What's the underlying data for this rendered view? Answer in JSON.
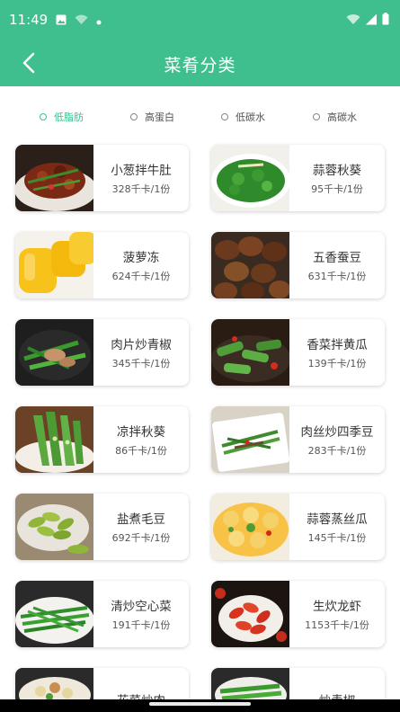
{
  "status_bar": {
    "time": "11:49",
    "left_icons": [
      "image-icon",
      "wifi-off-icon",
      "notification-dot-icon"
    ],
    "right_icons": [
      "wifi-icon",
      "signal-icon",
      "battery-icon"
    ]
  },
  "app_bar": {
    "title": "菜肴分类",
    "back_icon": "chevron-left-icon"
  },
  "colors": {
    "primary": "#3fbf8e"
  },
  "filters": [
    {
      "label": "低脂肪",
      "selected": true
    },
    {
      "label": "高蛋白",
      "selected": false
    },
    {
      "label": "低碳水",
      "selected": false
    },
    {
      "label": "高碳水",
      "selected": false
    }
  ],
  "dishes": [
    {
      "name": "小葱拌牛肚",
      "calories": "328千卡/1份"
    },
    {
      "name": "蒜蓉秋葵",
      "calories": "95千卡/1份"
    },
    {
      "name": "菠萝冻",
      "calories": "624千卡/1份"
    },
    {
      "name": "五香蚕豆",
      "calories": "631千卡/1份"
    },
    {
      "name": "肉片炒青椒",
      "calories": "345千卡/1份"
    },
    {
      "name": "香菜拌黄瓜",
      "calories": "139千卡/1份"
    },
    {
      "name": "凉拌秋葵",
      "calories": "86千卡/1份"
    },
    {
      "name": "肉丝炒四季豆",
      "calories": "283千卡/1份"
    },
    {
      "name": "盐煮毛豆",
      "calories": "692千卡/1份"
    },
    {
      "name": "蒜蓉蒸丝瓜",
      "calories": "145千卡/1份"
    },
    {
      "name": "清炒空心菜",
      "calories": "191千卡/1份"
    },
    {
      "name": "生炊龙虾",
      "calories": "1153千卡/1份"
    },
    {
      "name": "花菜炒肉",
      "calories": ""
    },
    {
      "name": "炒青椒",
      "calories": ""
    }
  ]
}
